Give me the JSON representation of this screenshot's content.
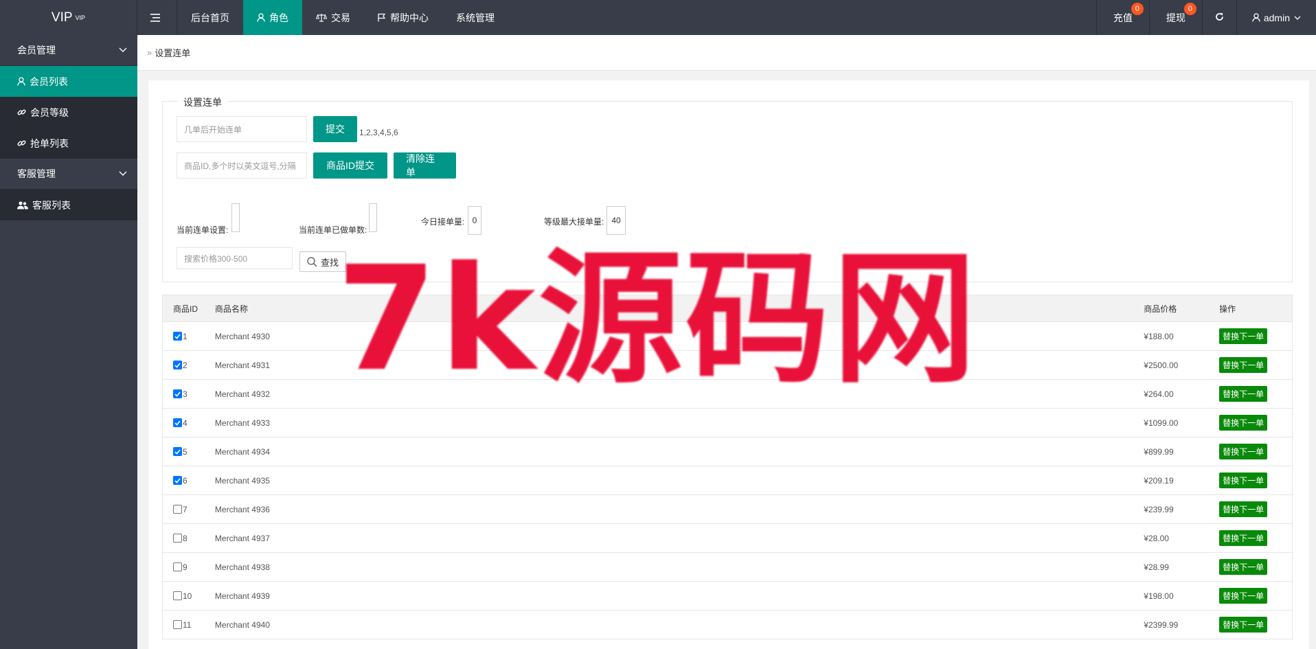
{
  "header": {
    "logo": "VIP",
    "logo_sup": "VIP",
    "nav": [
      "后台首页",
      "角色",
      "交易",
      "帮助中心",
      "系统管理"
    ],
    "right": {
      "recharge": "充值",
      "recharge_badge": "0",
      "withdraw": "提现",
      "withdraw_badge": "0",
      "user": "admin"
    }
  },
  "sidebar": {
    "group1": "会员管理",
    "items1": [
      "会员列表",
      "会员等级",
      "抢单列表"
    ],
    "group2": "客服管理",
    "items2": [
      "客服列表"
    ]
  },
  "breadcrumb": "设置连单",
  "form": {
    "legend": "设置连单",
    "start_placeholder": "几单后开始连单",
    "submit_label": "提交",
    "hint": "1,2,3,4,5,6",
    "ids_placeholder": "商品ID,多个时以英文逗号,分隔",
    "ids_submit_label": "商品ID提交",
    "clear_label": "清除连单",
    "current_setting_label": "当前连单设置:",
    "current_done_label": "当前连单已做单数:",
    "today_label": "今日接单量:",
    "today_value": "0",
    "max_label": "等级最大接单量:",
    "max_value": "40",
    "price_placeholder": "搜索价格300-500",
    "find_label": "查找"
  },
  "table": {
    "headers": {
      "id": "商品ID",
      "name": "商品名称",
      "price": "商品价格",
      "op": "操作"
    },
    "action_label": "替换下一单",
    "rows": [
      {
        "id": "1",
        "name": "Merchant 4930",
        "price": "¥188.00",
        "checked": true
      },
      {
        "id": "2",
        "name": "Merchant 4931",
        "price": "¥2500.00",
        "checked": true
      },
      {
        "id": "3",
        "name": "Merchant 4932",
        "price": "¥264.00",
        "checked": true
      },
      {
        "id": "4",
        "name": "Merchant 4933",
        "price": "¥1099.00",
        "checked": true
      },
      {
        "id": "5",
        "name": "Merchant 4934",
        "price": "¥899.99",
        "checked": true
      },
      {
        "id": "6",
        "name": "Merchant 4935",
        "price": "¥209.19",
        "checked": true
      },
      {
        "id": "7",
        "name": "Merchant 4936",
        "price": "¥239.99",
        "checked": false
      },
      {
        "id": "8",
        "name": "Merchant 4937",
        "price": "¥28.00",
        "checked": false
      },
      {
        "id": "9",
        "name": "Merchant 4938",
        "price": "¥28.99",
        "checked": false
      },
      {
        "id": "10",
        "name": "Merchant 4939",
        "price": "¥198.00",
        "checked": false
      },
      {
        "id": "11",
        "name": "Merchant 4940",
        "price": "¥2399.99",
        "checked": false
      }
    ]
  },
  "watermark": "7k源码网",
  "colors": {
    "header": "#393d49",
    "accent": "#009688",
    "badge": "#ff5722",
    "action": "#0a8a0a",
    "watermark": "#e8002b"
  }
}
